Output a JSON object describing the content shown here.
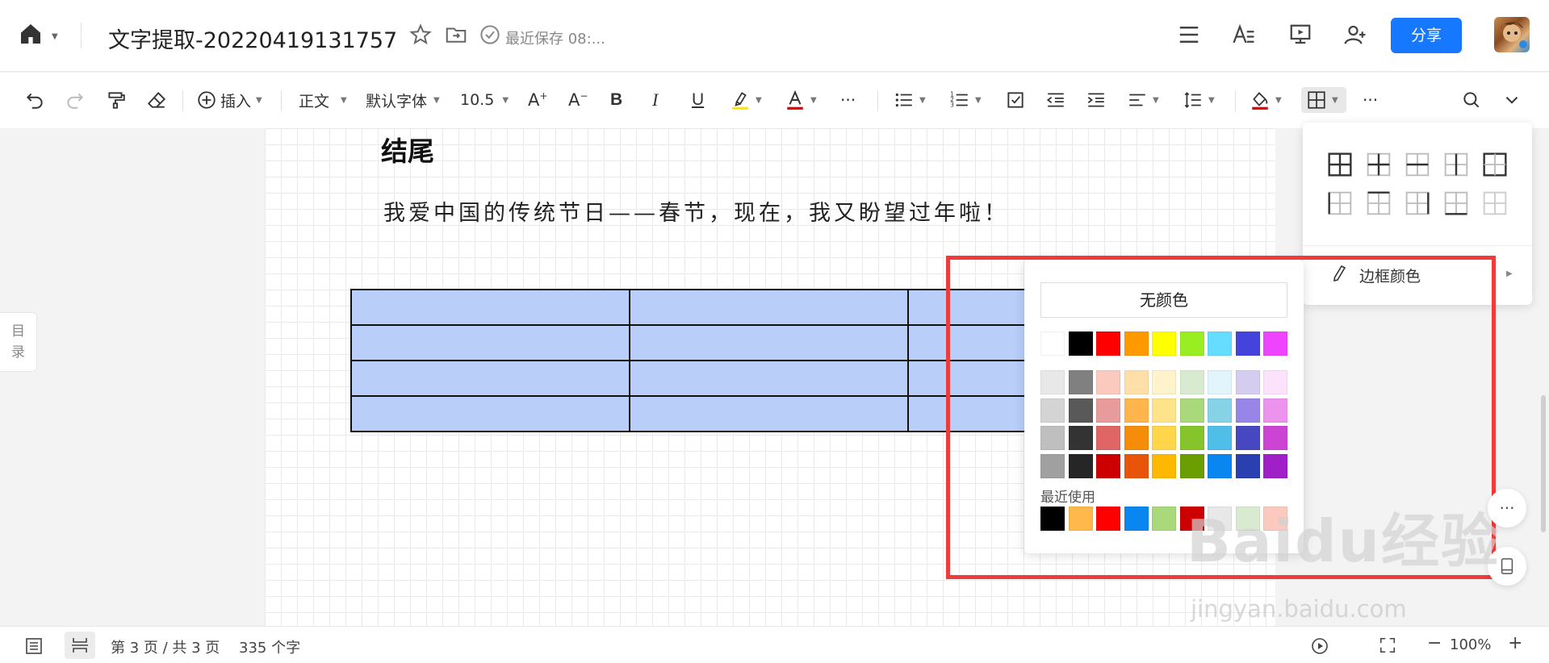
{
  "header": {
    "doc_title": "文字提取-20220419131757",
    "save_status": "最近保存 08:...",
    "share_label": "分享"
  },
  "toolbar": {
    "insert_label": "插入",
    "style_label": "正文",
    "font_label": "默认字体",
    "size_label": "10.5",
    "bold": "B",
    "italic": "I",
    "underline": "U",
    "more": "···"
  },
  "document": {
    "toc_label_1": "目",
    "toc_label_2": "录",
    "heading": "结尾",
    "paragraph": "我爱中国的传统节日——春节，现在，我又盼望过年啦！",
    "table": {
      "rows": 4,
      "cols": 3
    }
  },
  "table_menu": {
    "border_color_label": "边框颜色"
  },
  "color_picker": {
    "no_color_label": "无颜色",
    "recent_label": "最近使用",
    "base_colors": [
      "#ffffff",
      "#000000",
      "#ff0000",
      "#ff9900",
      "#ffff00",
      "#99ee22",
      "#66ddff",
      "#4444dd",
      "#ee44ff"
    ],
    "shades": [
      [
        "#e8e8e8",
        "#808080",
        "#fbc9bd",
        "#ffdfa8",
        "#fff3cc",
        "#d8ebd0",
        "#e2f5fc",
        "#d5cdef",
        "#fce3fb"
      ],
      [
        "#d4d4d4",
        "#595959",
        "#e89b9b",
        "#ffb44c",
        "#ffe38a",
        "#a9d97a",
        "#86d2e6",
        "#9786e8",
        "#ec93ee"
      ],
      [
        "#bfbfbf",
        "#333333",
        "#e06666",
        "#f58c0a",
        "#ffd54a",
        "#85c42b",
        "#4fbfea",
        "#4747c2",
        "#cc44d4"
      ],
      [
        "#a0a0a0",
        "#262626",
        "#cc0000",
        "#e8540a",
        "#ffb800",
        "#6b9e00",
        "#0a86f0",
        "#2a3fb0",
        "#a020c8"
      ]
    ],
    "recent": [
      "#000000",
      "#ffb84a",
      "#ff0000",
      "#0a86f0",
      "#a9d97a",
      "#cc0000",
      "#e8e8e8",
      "#d8ebd0",
      "#fbc9bd"
    ]
  },
  "status": {
    "page_info": "第 3 页 / 共 3 页",
    "word_count": "335 个字",
    "zoom": "100%"
  },
  "watermark": {
    "logo": "Baidu经验",
    "url": "jingyan.baidu.com"
  }
}
